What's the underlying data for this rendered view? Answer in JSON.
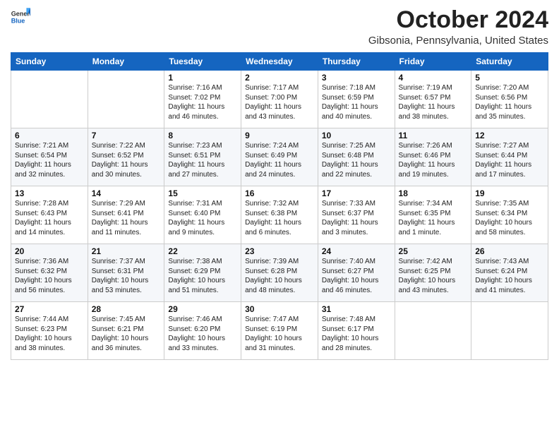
{
  "header": {
    "logo_general": "General",
    "logo_blue": "Blue",
    "month_title": "October 2024",
    "location": "Gibsonia, Pennsylvania, United States"
  },
  "days_of_week": [
    "Sunday",
    "Monday",
    "Tuesday",
    "Wednesday",
    "Thursday",
    "Friday",
    "Saturday"
  ],
  "weeks": [
    [
      {
        "day": "",
        "info": ""
      },
      {
        "day": "",
        "info": ""
      },
      {
        "day": "1",
        "info": "Sunrise: 7:16 AM\nSunset: 7:02 PM\nDaylight: 11 hours and 46 minutes."
      },
      {
        "day": "2",
        "info": "Sunrise: 7:17 AM\nSunset: 7:00 PM\nDaylight: 11 hours and 43 minutes."
      },
      {
        "day": "3",
        "info": "Sunrise: 7:18 AM\nSunset: 6:59 PM\nDaylight: 11 hours and 40 minutes."
      },
      {
        "day": "4",
        "info": "Sunrise: 7:19 AM\nSunset: 6:57 PM\nDaylight: 11 hours and 38 minutes."
      },
      {
        "day": "5",
        "info": "Sunrise: 7:20 AM\nSunset: 6:56 PM\nDaylight: 11 hours and 35 minutes."
      }
    ],
    [
      {
        "day": "6",
        "info": "Sunrise: 7:21 AM\nSunset: 6:54 PM\nDaylight: 11 hours and 32 minutes."
      },
      {
        "day": "7",
        "info": "Sunrise: 7:22 AM\nSunset: 6:52 PM\nDaylight: 11 hours and 30 minutes."
      },
      {
        "day": "8",
        "info": "Sunrise: 7:23 AM\nSunset: 6:51 PM\nDaylight: 11 hours and 27 minutes."
      },
      {
        "day": "9",
        "info": "Sunrise: 7:24 AM\nSunset: 6:49 PM\nDaylight: 11 hours and 24 minutes."
      },
      {
        "day": "10",
        "info": "Sunrise: 7:25 AM\nSunset: 6:48 PM\nDaylight: 11 hours and 22 minutes."
      },
      {
        "day": "11",
        "info": "Sunrise: 7:26 AM\nSunset: 6:46 PM\nDaylight: 11 hours and 19 minutes."
      },
      {
        "day": "12",
        "info": "Sunrise: 7:27 AM\nSunset: 6:44 PM\nDaylight: 11 hours and 17 minutes."
      }
    ],
    [
      {
        "day": "13",
        "info": "Sunrise: 7:28 AM\nSunset: 6:43 PM\nDaylight: 11 hours and 14 minutes."
      },
      {
        "day": "14",
        "info": "Sunrise: 7:29 AM\nSunset: 6:41 PM\nDaylight: 11 hours and 11 minutes."
      },
      {
        "day": "15",
        "info": "Sunrise: 7:31 AM\nSunset: 6:40 PM\nDaylight: 11 hours and 9 minutes."
      },
      {
        "day": "16",
        "info": "Sunrise: 7:32 AM\nSunset: 6:38 PM\nDaylight: 11 hours and 6 minutes."
      },
      {
        "day": "17",
        "info": "Sunrise: 7:33 AM\nSunset: 6:37 PM\nDaylight: 11 hours and 3 minutes."
      },
      {
        "day": "18",
        "info": "Sunrise: 7:34 AM\nSunset: 6:35 PM\nDaylight: 11 hours and 1 minute."
      },
      {
        "day": "19",
        "info": "Sunrise: 7:35 AM\nSunset: 6:34 PM\nDaylight: 10 hours and 58 minutes."
      }
    ],
    [
      {
        "day": "20",
        "info": "Sunrise: 7:36 AM\nSunset: 6:32 PM\nDaylight: 10 hours and 56 minutes."
      },
      {
        "day": "21",
        "info": "Sunrise: 7:37 AM\nSunset: 6:31 PM\nDaylight: 10 hours and 53 minutes."
      },
      {
        "day": "22",
        "info": "Sunrise: 7:38 AM\nSunset: 6:29 PM\nDaylight: 10 hours and 51 minutes."
      },
      {
        "day": "23",
        "info": "Sunrise: 7:39 AM\nSunset: 6:28 PM\nDaylight: 10 hours and 48 minutes."
      },
      {
        "day": "24",
        "info": "Sunrise: 7:40 AM\nSunset: 6:27 PM\nDaylight: 10 hours and 46 minutes."
      },
      {
        "day": "25",
        "info": "Sunrise: 7:42 AM\nSunset: 6:25 PM\nDaylight: 10 hours and 43 minutes."
      },
      {
        "day": "26",
        "info": "Sunrise: 7:43 AM\nSunset: 6:24 PM\nDaylight: 10 hours and 41 minutes."
      }
    ],
    [
      {
        "day": "27",
        "info": "Sunrise: 7:44 AM\nSunset: 6:23 PM\nDaylight: 10 hours and 38 minutes."
      },
      {
        "day": "28",
        "info": "Sunrise: 7:45 AM\nSunset: 6:21 PM\nDaylight: 10 hours and 36 minutes."
      },
      {
        "day": "29",
        "info": "Sunrise: 7:46 AM\nSunset: 6:20 PM\nDaylight: 10 hours and 33 minutes."
      },
      {
        "day": "30",
        "info": "Sunrise: 7:47 AM\nSunset: 6:19 PM\nDaylight: 10 hours and 31 minutes."
      },
      {
        "day": "31",
        "info": "Sunrise: 7:48 AM\nSunset: 6:17 PM\nDaylight: 10 hours and 28 minutes."
      },
      {
        "day": "",
        "info": ""
      },
      {
        "day": "",
        "info": ""
      }
    ]
  ]
}
